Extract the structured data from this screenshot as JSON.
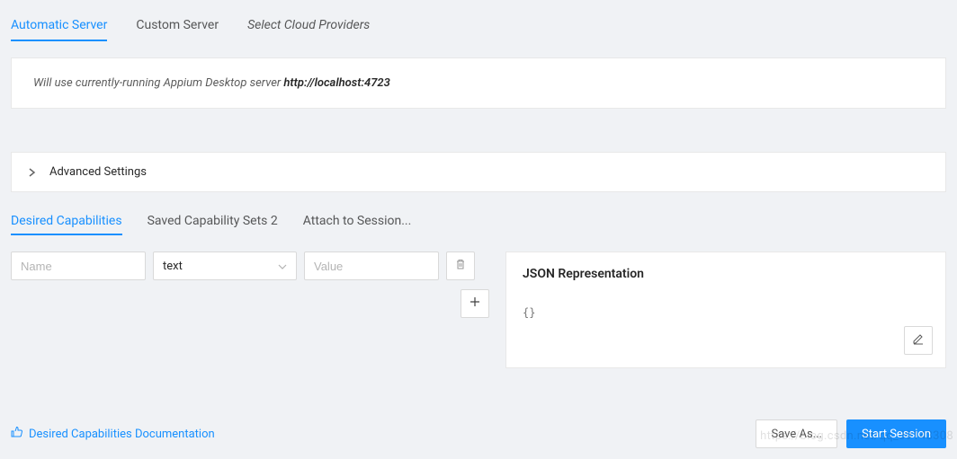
{
  "serverTabs": {
    "automatic": "Automatic Server",
    "custom": "Custom Server",
    "cloud": "Select Cloud Providers"
  },
  "serverInfo": {
    "prefix": "Will use currently-running Appium Desktop server ",
    "host": "http://localhost:4723"
  },
  "advancedSettings": {
    "label": "Advanced Settings"
  },
  "capabilityTabs": {
    "desired": "Desired Capabilities",
    "saved": "Saved Capability Sets 2",
    "attach": "Attach to Session..."
  },
  "capabilityRow": {
    "namePlaceholder": "Name",
    "typeValue": "text",
    "valuePlaceholder": "Value"
  },
  "jsonRepresentation": {
    "title": "JSON Representation",
    "content": "{}"
  },
  "footer": {
    "docLink": "Desired Capabilities Documentation",
    "saveAs": "Save As...",
    "startSession": "Start Session"
  },
  "watermark": "https://blog.csdn.net/qq_39143308"
}
